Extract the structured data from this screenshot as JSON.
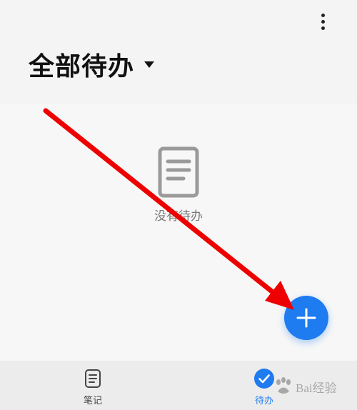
{
  "header": {
    "title": "全部待办",
    "more_icon": "more-vertical-icon",
    "dropdown_icon": "caret-down-icon"
  },
  "empty_state": {
    "icon": "document-icon",
    "text": "没有待办"
  },
  "fab": {
    "icon": "plus-icon",
    "color": "#1e7bf0"
  },
  "annotation": {
    "arrow_color": "#ee0000"
  },
  "bottom_nav": {
    "tabs": [
      {
        "label": "笔记",
        "icon": "note-icon",
        "active": false
      },
      {
        "label": "待办",
        "icon": "check-circle-icon",
        "active": true
      }
    ]
  },
  "watermark": {
    "text": "Bai经验",
    "logo": "paw-logo"
  },
  "colors": {
    "accent": "#1e7bf0",
    "background": "#f4f4f4",
    "nav_background": "#ececec"
  }
}
